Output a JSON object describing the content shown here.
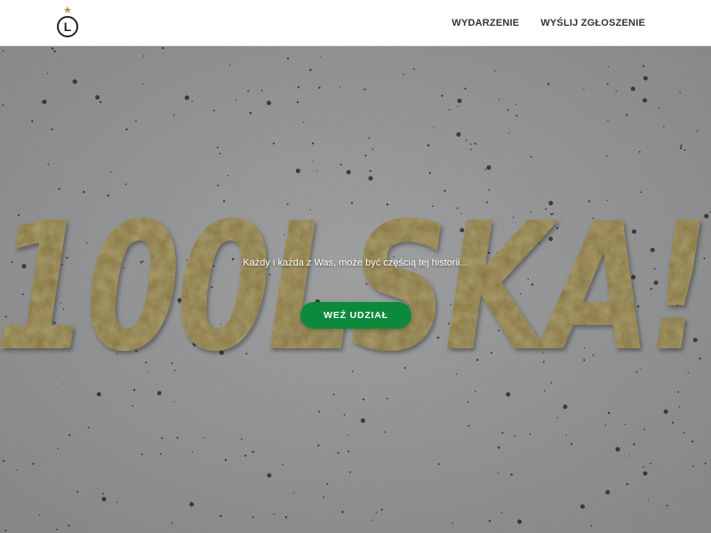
{
  "header": {
    "logo_icon": "legia-l-crest-icon",
    "logo_letter": "L",
    "nav": [
      {
        "label": "WYDARZENIE"
      },
      {
        "label": "WYŚLIJ ZGŁOSZENIE"
      }
    ]
  },
  "hero": {
    "background": "concrete-texture",
    "wordmark": "100LSKA!",
    "tagline": "Każdy i każda z Was, może być częścią tej historii...",
    "cta_label": "WEŹ UDZIAŁ",
    "colors": {
      "gold": "#8c7a3e",
      "cta_green": "#0c8a3c",
      "concrete": "#8d8e8f"
    }
  }
}
